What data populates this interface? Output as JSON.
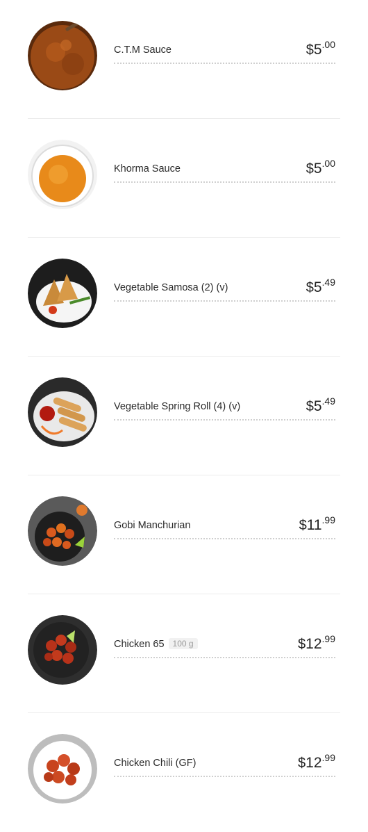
{
  "menu": {
    "items": [
      {
        "name": "C.T.M Sauce",
        "weight": "",
        "currency": "$",
        "price_int": "5",
        "price_cents": ".00",
        "image": "ctm-sauce-image"
      },
      {
        "name": "Khorma Sauce",
        "weight": "",
        "currency": "$",
        "price_int": "5",
        "price_cents": ".00",
        "image": "khorma-sauce-image"
      },
      {
        "name": "Vegetable Samosa (2) (v)",
        "weight": "",
        "currency": "$",
        "price_int": "5",
        "price_cents": ".49",
        "image": "samosa-image"
      },
      {
        "name": "Vegetable Spring Roll (4) (v)",
        "weight": "",
        "currency": "$",
        "price_int": "5",
        "price_cents": ".49",
        "image": "spring-roll-image"
      },
      {
        "name": "Gobi Manchurian",
        "weight": "",
        "currency": "$",
        "price_int": "11",
        "price_cents": ".99",
        "image": "gobi-manchurian-image"
      },
      {
        "name": "Chicken 65",
        "weight": "100 g",
        "currency": "$",
        "price_int": "12",
        "price_cents": ".99",
        "image": "chicken-65-image"
      },
      {
        "name": "Chicken Chili (GF)",
        "weight": "",
        "currency": "$",
        "price_int": "12",
        "price_cents": ".99",
        "image": "chicken-chili-image"
      }
    ]
  },
  "colors": {
    "text": "#222222",
    "divider": "#ececec",
    "dotted_leader": "#cfcfcf",
    "weight_badge_bg": "#f1f1f1"
  }
}
